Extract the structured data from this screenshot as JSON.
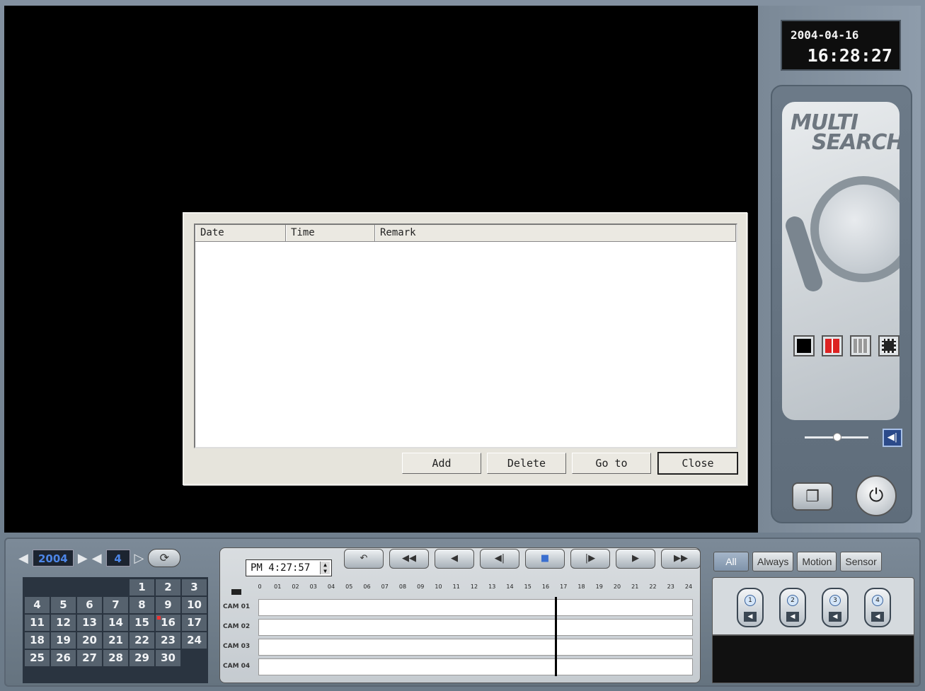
{
  "clock": {
    "date": "2004-04-16",
    "time": "16:28:27"
  },
  "logo": {
    "line1": "MULTI",
    "line2": "SEARCH"
  },
  "view_buttons": [
    "single-view-icon",
    "quad-view-icon",
    "nine-view-icon",
    "sixteen-view-icon"
  ],
  "volume": {
    "level": 0.5
  },
  "dialog": {
    "columns": [
      "Date",
      "Time",
      "Remark"
    ],
    "buttons": {
      "add": "Add",
      "delete": "Delete",
      "goto": "Go to",
      "close": "Close"
    }
  },
  "calendar": {
    "year": "2004",
    "month": "4",
    "selected_day": "16",
    "days": [
      "",
      "",
      "",
      "",
      "1",
      "2",
      "3",
      "4",
      "5",
      "6",
      "7",
      "8",
      "9",
      "10",
      "11",
      "12",
      "13",
      "14",
      "15",
      "16",
      "17",
      "18",
      "19",
      "20",
      "21",
      "22",
      "23",
      "24",
      "25",
      "26",
      "27",
      "28",
      "29",
      "30",
      ""
    ]
  },
  "search_time": "PM  4:27:57",
  "timeline": {
    "hours": [
      "0",
      "01",
      "02",
      "03",
      "04",
      "05",
      "06",
      "07",
      "08",
      "09",
      "10",
      "11",
      "12",
      "13",
      "14",
      "15",
      "16",
      "17",
      "18",
      "19",
      "20",
      "21",
      "22",
      "23",
      "24"
    ],
    "cameras": [
      "CAM 01",
      "CAM 02",
      "CAM 03",
      "CAM 04"
    ],
    "cursor_hour": 16.5
  },
  "modes": {
    "all": "All",
    "always": "Always",
    "motion": "Motion",
    "sensor": "Sensor"
  },
  "camera_buttons": [
    "1",
    "2",
    "3",
    "4"
  ],
  "colors": {
    "accent_blue": "#4d86e8",
    "today_mark": "#e33333"
  }
}
